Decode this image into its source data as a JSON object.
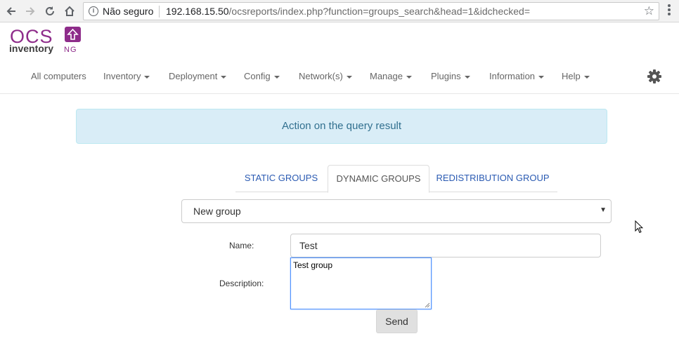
{
  "browser": {
    "security_label": "Não seguro",
    "url_host": "192.168.15.50",
    "url_path": "/ocsreports/index.php?function=groups_search&head=1&idchecked="
  },
  "icons": {
    "back": "arrow-left-icon",
    "forward": "arrow-right-icon",
    "reload": "reload-icon",
    "home": "home-icon",
    "info": "info-icon",
    "bookmark": "star-icon",
    "browser_menu": "kebab-menu-icon",
    "settings": "gear-icon",
    "cursor": "mouse-cursor-icon"
  },
  "logo": {
    "main": "OCS",
    "sub": "inventory",
    "suffix": "NG"
  },
  "nav": {
    "items": [
      {
        "label": "All computers",
        "has_caret": false
      },
      {
        "label": "Inventory",
        "has_caret": true
      },
      {
        "label": "Deployment",
        "has_caret": true
      },
      {
        "label": "Config",
        "has_caret": true
      },
      {
        "label": "Network(s)",
        "has_caret": true
      },
      {
        "label": "Manage",
        "has_caret": true
      },
      {
        "label": "Plugins",
        "has_caret": true
      },
      {
        "label": "Information",
        "has_caret": true
      },
      {
        "label": "Help",
        "has_caret": true
      }
    ]
  },
  "alert": {
    "text": "Action on the query result"
  },
  "tabs": [
    {
      "label": "STATIC GROUPS",
      "active": false
    },
    {
      "label": "DYNAMIC GROUPS",
      "active": true
    },
    {
      "label": "REDISTRIBUTION GROUP",
      "active": false
    }
  ],
  "group_select": {
    "selected": "New group"
  },
  "form": {
    "name_label": "Name:",
    "name_value": "Test",
    "description_label": "Description:",
    "description_value": "Test group",
    "send_label": "Send"
  },
  "colors": {
    "logo_purple": "#8e2c8a",
    "link_blue": "#2a5ab2",
    "alert_bg": "#d9edf7",
    "alert_text": "#31708f",
    "focus_blue": "#4d90fe"
  }
}
